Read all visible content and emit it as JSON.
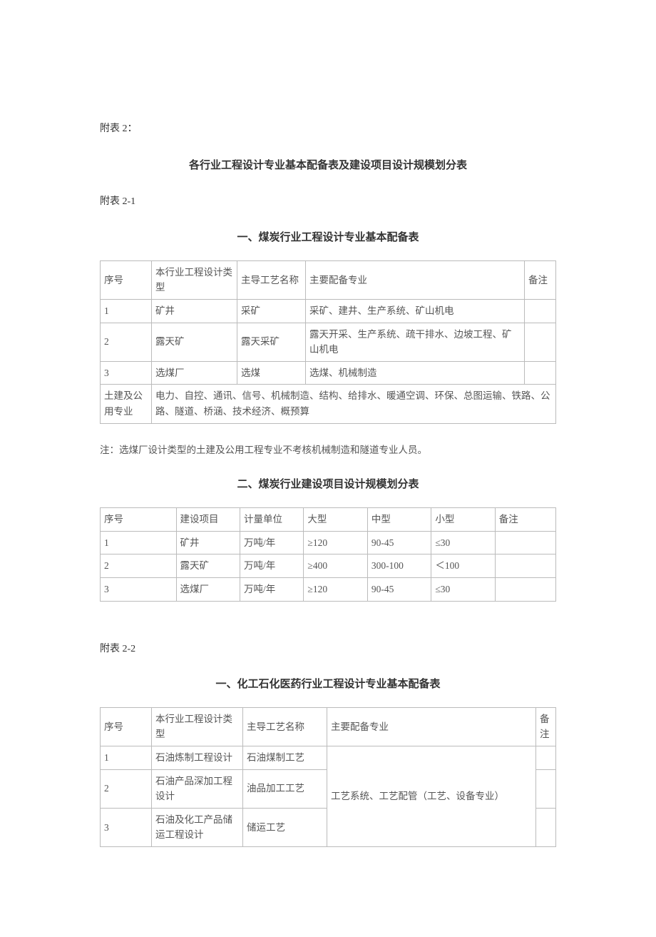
{
  "appendix_label": "附表 2：",
  "main_title": "各行业工程设计专业基本配备表及建设项目设计规模划分表",
  "appendix_2_1": "附表 2-1",
  "section1": {
    "title": "一、煤炭行业工程设计专业基本配备表",
    "headers": {
      "c1": "序号",
      "c2": "本行业工程设计类型",
      "c3": "主导工艺名称",
      "c4": "主要配备专业",
      "c5": "备注"
    },
    "rows": [
      {
        "n": "1",
        "type": "矿井",
        "craft": "采矿",
        "majors": "采矿、建井、生产系统、矿山机电",
        "note": ""
      },
      {
        "n": "2",
        "type": "露天矿",
        "craft": "露天采矿",
        "majors": "露天开采、生产系统、疏干排水、边坡工程、矿山机电",
        "note": ""
      },
      {
        "n": "3",
        "type": "选煤厂",
        "craft": "选煤",
        "majors": "选煤、机械制造",
        "note": ""
      }
    ],
    "shared": {
      "label": "土建及公用专业",
      "content": "电力、自控、通讯、信号、机械制造、结构、给排水、暖通空调、环保、总图运输、铁路、公路、隧道、桥涵、技术经济、概预算"
    },
    "footnote": "注：选煤厂设计类型的土建及公用工程专业不考核机械制造和隧道专业人员。"
  },
  "section2": {
    "title": "二、煤炭行业建设项目设计规模划分表",
    "headers": {
      "c1": "序号",
      "c2": "建设项目",
      "c3": "计量单位",
      "c4": "大型",
      "c5": "中型",
      "c6": "小型",
      "c7": "备注"
    },
    "rows": [
      {
        "n": "1",
        "proj": "矿井",
        "unit": "万吨/年",
        "lg": "≥120",
        "md": "90-45",
        "sm": "≤30",
        "note": ""
      },
      {
        "n": "2",
        "proj": "露天矿",
        "unit": "万吨/年",
        "lg": "≥400",
        "md": "300-100",
        "sm": "＜100",
        "note": ""
      },
      {
        "n": "3",
        "proj": "选煤厂",
        "unit": "万吨/年",
        "lg": "≥120",
        "md": "90-45",
        "sm": "≤30",
        "note": ""
      }
    ]
  },
  "appendix_2_2": "附表 2-2",
  "section3": {
    "title": "一、化工石化医药行业工程设计专业基本配备表",
    "headers": {
      "c1": "序号",
      "c2": "本行业工程设计类型",
      "c3": "主导工艺名称",
      "c4": "主要配备专业",
      "c5": "备注"
    },
    "rows": [
      {
        "n": "1",
        "type": "石油炼制工程设计",
        "craft": "石油煤制工艺",
        "note": ""
      },
      {
        "n": "2",
        "type": "石油产品深加工程设计",
        "craft": "油品加工工艺",
        "note": ""
      },
      {
        "n": "3",
        "type": "石油及化工产品储运工程设计",
        "craft": "储运工艺",
        "note": ""
      }
    ],
    "merged_majors": "工艺系统、工艺配管（工艺、设备专业）"
  }
}
